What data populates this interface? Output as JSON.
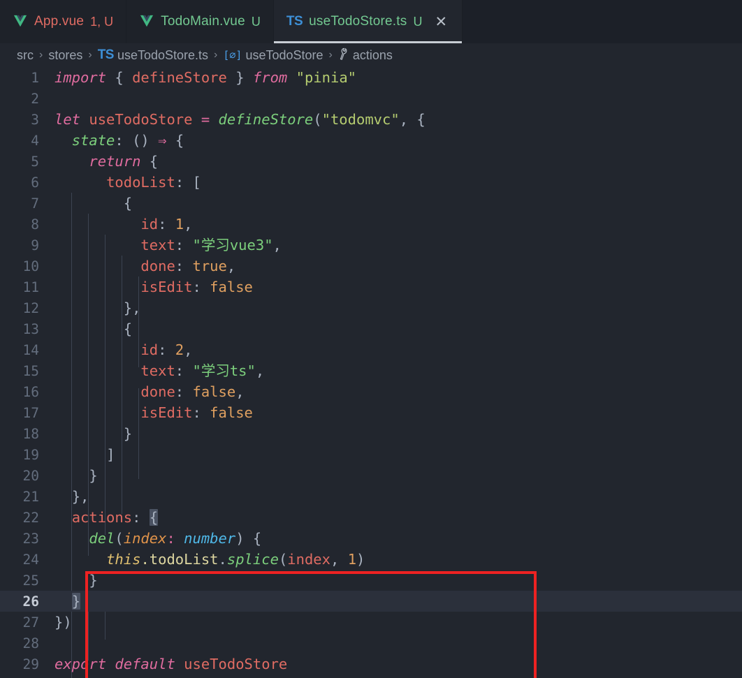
{
  "window": {
    "app": "visual-studio-code",
    "theme_colors": {
      "editor_bg": "#22262e",
      "tabbar_bg": "#1c2028",
      "inactive_tab_bg": "#1e2229",
      "active_tab_border": "#c8cdd4",
      "current_line_bg": "#2b303b",
      "line_number": "#636d7d",
      "active_line_number": "#c6ccd6",
      "indent_guide": "#3c4452",
      "annotation_red": "#ee2222",
      "bracket_match_bg": "#4a5262"
    }
  },
  "tabs": [
    {
      "icon": "vue-icon",
      "label": "App.vue",
      "badge": "1, U",
      "state": "inactive",
      "has_error": true,
      "closable": false
    },
    {
      "icon": "vue-icon",
      "label": "TodoMain.vue",
      "badge": "U",
      "state": "inactive",
      "has_error": false,
      "closable": false
    },
    {
      "icon": "ts-icon",
      "icon_text": "TS",
      "label": "useTodoStore.ts",
      "badge": "U",
      "state": "active",
      "has_error": false,
      "closable": true,
      "close_glyph": "✕"
    }
  ],
  "breadcrumb": {
    "separator": "›",
    "items": [
      {
        "label": "src",
        "icon": ""
      },
      {
        "label": "stores",
        "icon": ""
      },
      {
        "label": "useTodoStore.ts",
        "icon": "ts-icon",
        "icon_text": "TS"
      },
      {
        "label": "useTodoStore",
        "icon": "interface-icon",
        "icon_text": "[∅]"
      },
      {
        "label": "actions",
        "icon": "wrench-icon",
        "icon_text": "🔧"
      }
    ]
  },
  "editor": {
    "language": "typescript",
    "file_name": "useTodoStore.ts",
    "active_line": 26,
    "first_visible_line": 1,
    "last_visible_line": 29,
    "annotation": {
      "type": "red-rectangle",
      "covers_lines": [
        22,
        26
      ],
      "color": "#ee2222"
    },
    "lines": [
      {
        "n": 1,
        "text": "import { defineStore } from \"pinia\""
      },
      {
        "n": 2,
        "text": ""
      },
      {
        "n": 3,
        "text": "let useTodoStore = defineStore(\"todomvc\", {"
      },
      {
        "n": 4,
        "text": "  state: () => {"
      },
      {
        "n": 5,
        "text": "    return {"
      },
      {
        "n": 6,
        "text": "      todoList: ["
      },
      {
        "n": 7,
        "text": "        {"
      },
      {
        "n": 8,
        "text": "          id: 1,"
      },
      {
        "n": 9,
        "text": "          text: \"学习vue3\","
      },
      {
        "n": 10,
        "text": "          done: true,"
      },
      {
        "n": 11,
        "text": "          isEdit: false"
      },
      {
        "n": 12,
        "text": "        },"
      },
      {
        "n": 13,
        "text": "        {"
      },
      {
        "n": 14,
        "text": "          id: 2,"
      },
      {
        "n": 15,
        "text": "          text: \"学习ts\","
      },
      {
        "n": 16,
        "text": "          done: false,"
      },
      {
        "n": 17,
        "text": "          isEdit: false"
      },
      {
        "n": 18,
        "text": "        }"
      },
      {
        "n": 19,
        "text": "      ]"
      },
      {
        "n": 20,
        "text": "    }"
      },
      {
        "n": 21,
        "text": "  },"
      },
      {
        "n": 22,
        "text": "  actions: {"
      },
      {
        "n": 23,
        "text": "    del(index: number) {"
      },
      {
        "n": 24,
        "text": "      this.todoList.splice(index, 1)"
      },
      {
        "n": 25,
        "text": "    }"
      },
      {
        "n": 26,
        "text": "  }"
      },
      {
        "n": 27,
        "text": "})"
      },
      {
        "n": 28,
        "text": ""
      },
      {
        "n": 29,
        "text": "export default useTodoStore"
      }
    ]
  }
}
